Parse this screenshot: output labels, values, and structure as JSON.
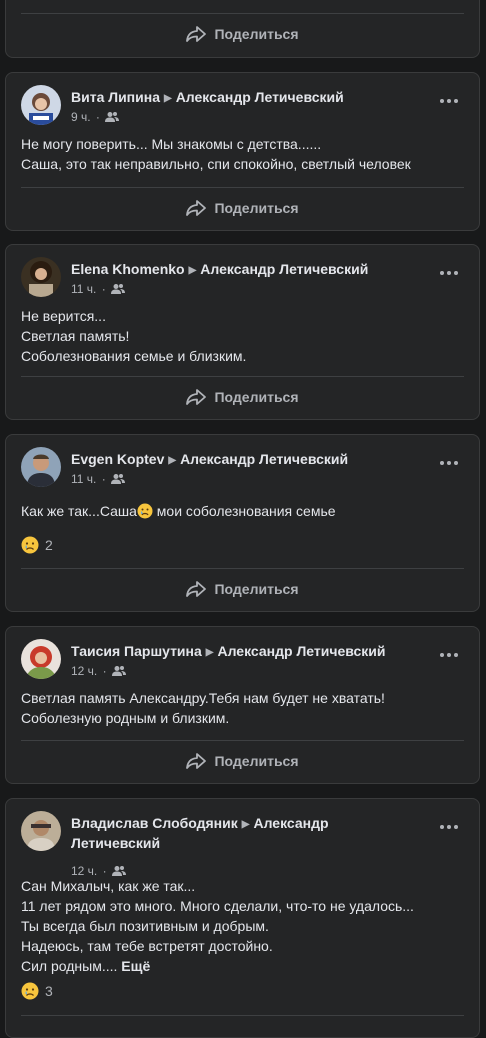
{
  "share_label": "Поделиться",
  "posts": [
    {
      "author": "Вита Липина",
      "target": "Александр Летичевский",
      "time": "9 ч.",
      "lines": [
        "Не могу поверить... Мы знакомы с детства......",
        "Саша, это так неправильно, спи спокойно, светлый человек"
      ]
    },
    {
      "author": "Elena Khomenko",
      "target": "Александр Летичевский",
      "time": "11 ч.",
      "lines": [
        "Не верится...",
        "Светлая память!",
        "Соболезнования семье и близким."
      ]
    },
    {
      "author": "Evgen Koptev",
      "target": "Александр Летичевский",
      "time": "11 ч.",
      "lines_a": "Как же так...Саша",
      "lines_b": " мои соболезнования семье",
      "reactions": "2"
    },
    {
      "author": "Таисия Паршутина",
      "target": "Александр Летичевский",
      "time": "12 ч.",
      "lines": [
        "Светлая память Александру.Тебя нам будет не хватать!",
        "Соболезную родным и близким."
      ]
    },
    {
      "author": "Владислав Слободяник",
      "target": "Александр",
      "target2": "Летичевский",
      "time": "12 ч.",
      "lines": [
        "Сан Михалыч, как же так...",
        "11 лет рядом это много. Много сделали, что-то не удалось...",
        "Ты всегда был позитивным и добрым.",
        "Надеюсь, там тебе встретят достойно.",
        "Сил родным...."
      ],
      "see_more": "Ещё",
      "reactions": "3"
    }
  ],
  "icons": {
    "share": "share-arrow-icon",
    "audience": "friends-icon",
    "more": "more-dots-icon",
    "reaction": "sad-reaction-icon"
  }
}
